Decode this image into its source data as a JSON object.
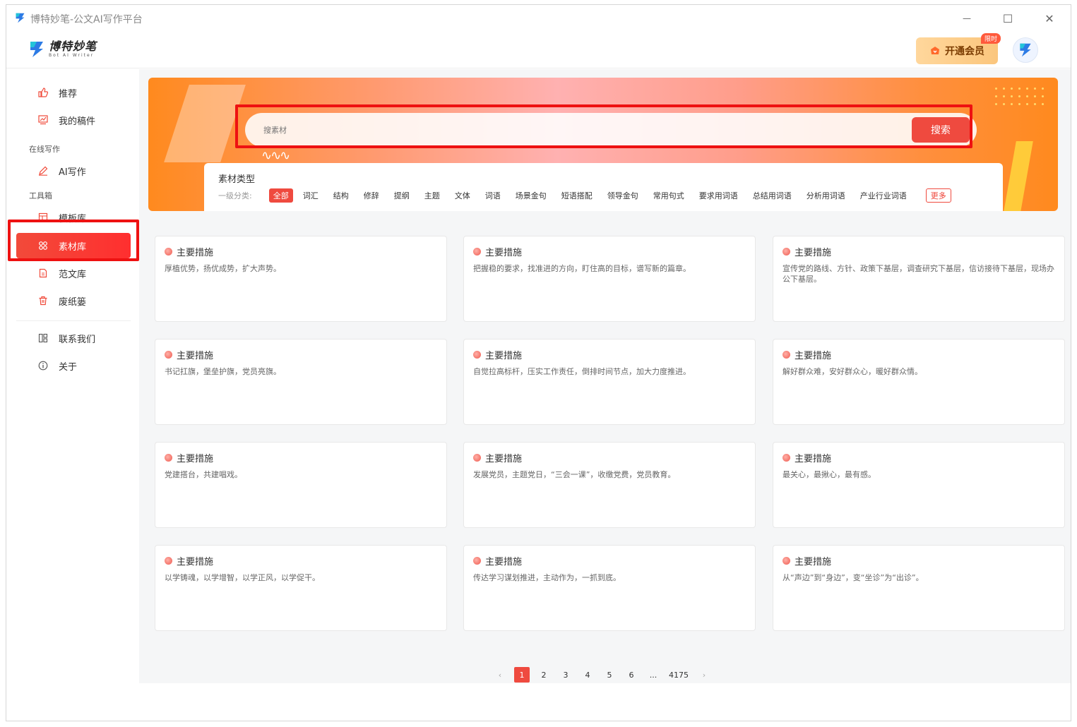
{
  "window": {
    "title": "博特妙笔-公文AI写作平台",
    "controls": {
      "minimize": "—",
      "maximize": "☐",
      "close": "✕"
    }
  },
  "header": {
    "logo_text": "博特妙笔",
    "logo_sub": "Bot AI Writer",
    "vip_label": "开通会员",
    "vip_tag": "限时"
  },
  "sidebar": {
    "items": [
      {
        "label": "推荐",
        "icon": "thumbs-up-icon"
      },
      {
        "label": "我的稿件",
        "icon": "document-chart-icon"
      }
    ],
    "section_online": "在线写作",
    "ai_write": {
      "label": "AI写作",
      "icon": "pen-icon"
    },
    "section_tools": "工具箱",
    "tools": [
      {
        "label": "模板库",
        "icon": "template-icon"
      },
      {
        "label": "素材库",
        "icon": "grid-icon",
        "active": true
      },
      {
        "label": "范文库",
        "icon": "file-icon"
      },
      {
        "label": "废纸篓",
        "icon": "trash-icon"
      }
    ],
    "bottom": [
      {
        "label": "联系我们",
        "icon": "contact-icon"
      },
      {
        "label": "关于",
        "icon": "info-icon"
      }
    ]
  },
  "search": {
    "placeholder": "搜素材",
    "button_label": "搜索"
  },
  "categories": {
    "title": "素材类型",
    "level_label": "一级分类:",
    "items": [
      "全部",
      "词汇",
      "结构",
      "修辞",
      "提纲",
      "主题",
      "文体",
      "词语",
      "场景金句",
      "短语搭配",
      "领导金句",
      "常用句式",
      "要求用词语",
      "总结用词语",
      "分析用词语",
      "产业行业词语"
    ],
    "active_index": 0,
    "more_label": "更多"
  },
  "cards": [
    {
      "title": "主要措施",
      "text": "厚植优势，扬优成势，扩大声势。"
    },
    {
      "title": "主要措施",
      "text": "把握稳的要求，找准进的方向，盯住高的目标，谱写新的篇章。"
    },
    {
      "title": "主要措施",
      "text": "宣传党的路线、方针、政策下基层，调查研究下基层，信访接待下基层，现场办公下基层。"
    },
    {
      "title": "主要措施",
      "text": "书记扛旗，堡垒护旗，党员亮旗。"
    },
    {
      "title": "主要措施",
      "text": "自觉拉高标杆，压实工作责任，倒排时间节点，加大力度推进。"
    },
    {
      "title": "主要措施",
      "text": "解好群众难，安好群众心，暖好群众情。"
    },
    {
      "title": "主要措施",
      "text": "党建搭台，共建唱戏。"
    },
    {
      "title": "主要措施",
      "text": "发展党员，主题党日，“三会一课”，收缴党费，党员教育。"
    },
    {
      "title": "主要措施",
      "text": "最关心，最揪心，最有感。"
    },
    {
      "title": "主要措施",
      "text": "以学铸魂，以学增智，以学正风，以学促干。"
    },
    {
      "title": "主要措施",
      "text": "传达学习谋划推进，主动作为，一抓到底。"
    },
    {
      "title": "主要措施",
      "text": "从“声边”到“身边”，变“坐诊”为“出诊”。"
    }
  ],
  "pagination": {
    "prev": "‹",
    "pages": [
      "1",
      "2",
      "3",
      "4",
      "5",
      "6"
    ],
    "ellipsis": "...",
    "last": "4175",
    "next": "›",
    "current": 1
  },
  "colors": {
    "accent": "#ef4a3f",
    "highlight": "#ee1111",
    "vip_gold": "#fbc67d"
  }
}
